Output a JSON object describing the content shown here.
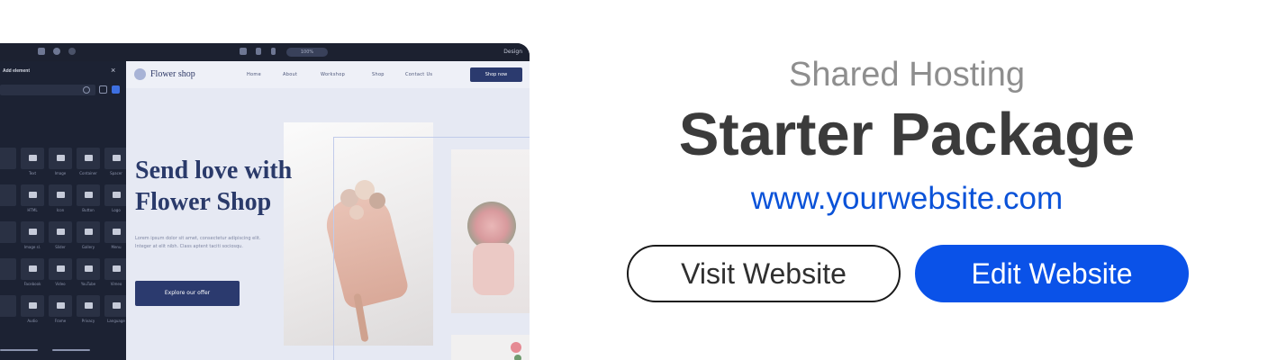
{
  "preview": {
    "toolbar": {
      "zoom": "100%",
      "design_label": "Design"
    },
    "panel": {
      "title": "Add element",
      "widgets": [
        "Text",
        "Image",
        "Container",
        "Spacer",
        "HTML",
        "Icon",
        "Button",
        "Logo",
        "Image sl.",
        "Slider",
        "Gallery",
        "Menu",
        "Facebook",
        "Video",
        "YouTube",
        "Vimeo",
        "Audio",
        "Frame",
        "Privacy",
        "Language"
      ]
    },
    "site": {
      "logo_text": "Flower shop",
      "nav": [
        "Home",
        "About",
        "Workshop",
        "Shop",
        "Contact Us"
      ],
      "shop_button": "Shop now",
      "hero_title_line1": "Send love with",
      "hero_title_line2": "Flower Shop",
      "hero_body": "Lorem ipsum dolor sit amet, consectetur adipiscing elit. Integer at elit nibh. Class aptent taciti sociosqu.",
      "hero_button": "Explore our offer"
    },
    "colors": {
      "editor_bg": "#1f2535",
      "site_bg": "#e6e9f3",
      "brand_navy": "#2b3a6e"
    }
  },
  "info": {
    "subtitle": "Shared Hosting",
    "title": "Starter Package",
    "domain": "www.yourwebsite.com",
    "visit_button": "Visit Website",
    "edit_button": "Edit Website"
  },
  "colors": {
    "accent": "#0a52e8",
    "link": "#0a52d8",
    "title": "#3b3b3b",
    "subtitle": "#8e8e8e"
  }
}
